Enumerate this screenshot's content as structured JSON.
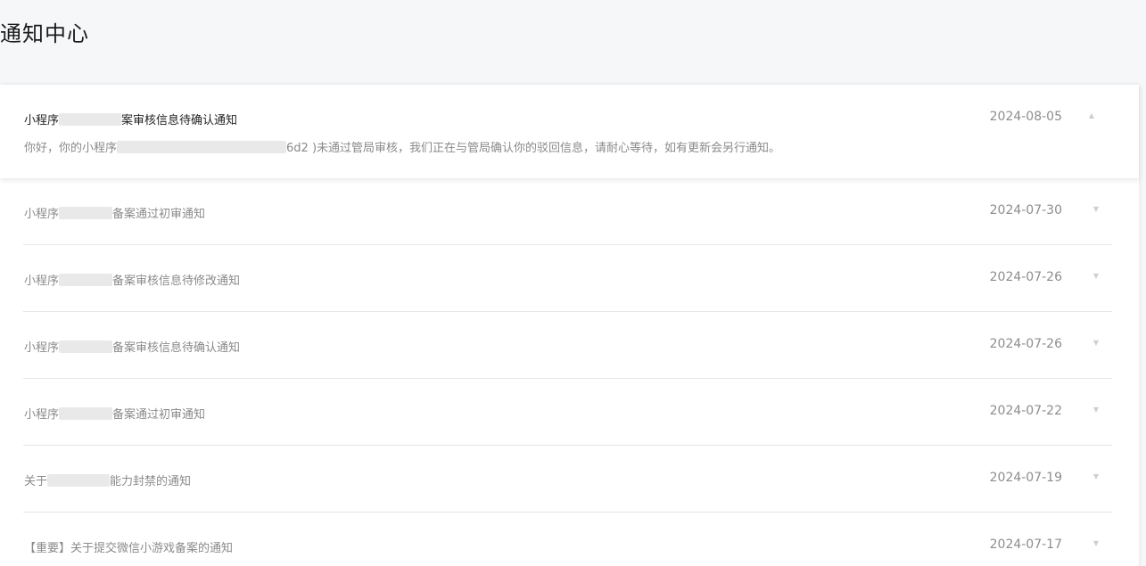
{
  "page": {
    "title": "通知中心"
  },
  "notifications": [
    {
      "title_prefix": "小程序",
      "title_suffix": "案审核信息待确认通知",
      "date": "2024-08-05",
      "expanded": true,
      "body_prefix": "你好，你的小程序",
      "body_mid": "6d2 )未通过管局审核，我们正在与管局确认你的驳回信息，请耐心等待，如有更新会另行通知。",
      "chevron": "chevron-up-icon"
    },
    {
      "title_prefix": "小程序",
      "title_suffix": "备案通过初审通知",
      "date": "2024-07-30",
      "expanded": false,
      "chevron": "chevron-down-icon"
    },
    {
      "title_prefix": "小程序",
      "title_suffix": "备案审核信息待修改通知",
      "date": "2024-07-26",
      "expanded": false,
      "chevron": "chevron-down-icon"
    },
    {
      "title_prefix": "小程序",
      "title_suffix": "备案审核信息待确认通知",
      "date": "2024-07-26",
      "expanded": false,
      "chevron": "chevron-down-icon"
    },
    {
      "title_prefix": "小程序",
      "title_suffix": "备案通过初审通知",
      "date": "2024-07-22",
      "expanded": false,
      "chevron": "chevron-down-icon"
    },
    {
      "title_prefix": "关于",
      "title_suffix": "能力封禁的通知",
      "date": "2024-07-19",
      "expanded": false,
      "chevron": "chevron-down-icon"
    },
    {
      "title_prefix": "【重要】关于提交微信小游戏备案的通知",
      "title_suffix": "",
      "date": "2024-07-17",
      "expanded": false,
      "chevron": "chevron-down-icon"
    }
  ],
  "colors": {
    "background": "#f6f7f9",
    "card": "#ffffff",
    "title_text": "#1c1c1c",
    "muted_text": "#8a8a8a",
    "divider": "#e7e7e7"
  }
}
